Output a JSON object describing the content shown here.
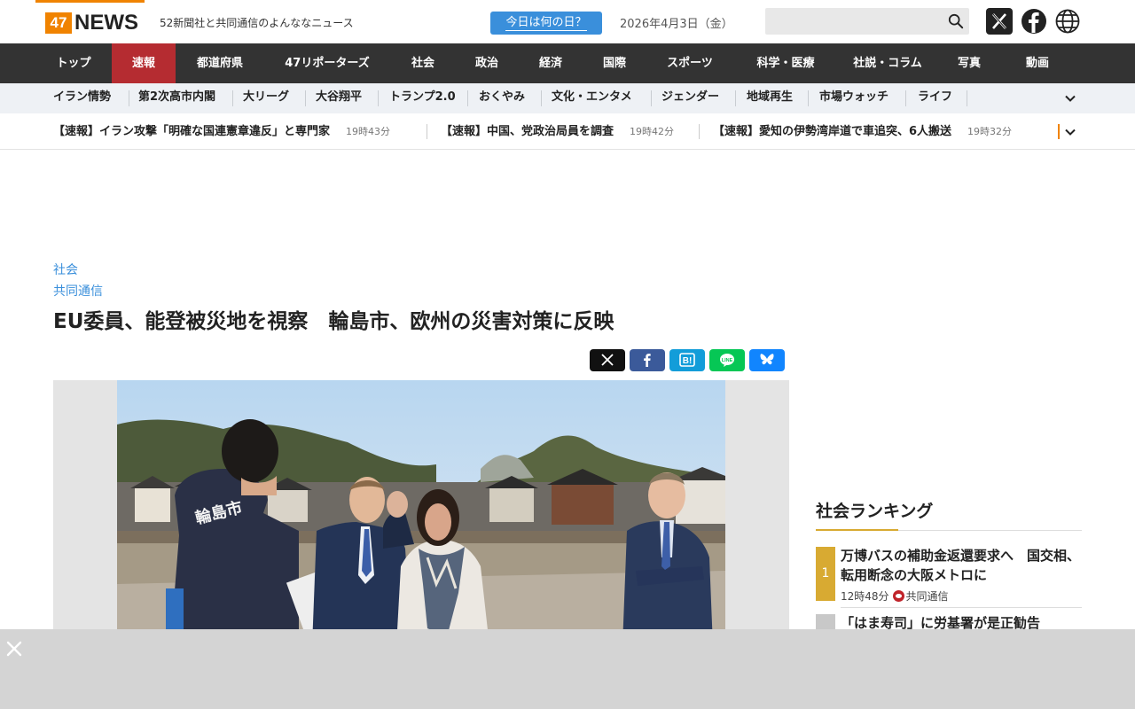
{
  "header": {
    "logo_num": "47",
    "logo_word": "NEWS",
    "tagline": "52新聞社と共同通信のよんななニュース",
    "today_button": "今日は何の日？",
    "date": "2026年4月3日（金）",
    "search_placeholder": ""
  },
  "main_nav": [
    "トップ",
    "速報",
    "都道府県",
    "47リポーターズ",
    "社会",
    "政治",
    "経済",
    "国際",
    "スポーツ",
    "科学・医療",
    "社説・コラム",
    "写真",
    "動画"
  ],
  "main_nav_active": "速報",
  "sub_nav": [
    "イラン情勢",
    "第2次高市内閣",
    "大リーグ",
    "大谷翔平",
    "トランプ2.0",
    "おくやみ",
    "文化・エンタメ",
    "ジェンダー",
    "地域再生",
    "市場ウォッチ",
    "ライフ"
  ],
  "ticker": [
    {
      "text": "【速報】イラン攻撃「明確な国連憲章違反」と専門家",
      "time": "19時43分"
    },
    {
      "text": "【速報】中国、党政治局員を調査",
      "time": "19時42分"
    },
    {
      "text": "【速報】愛知の伊勢湾岸道で車追突、6人搬送",
      "time": "19時32分"
    }
  ],
  "article": {
    "category": "社会",
    "source": "共同通信",
    "headline": "EU委員、能登被災地を視察　輪島市、欧州の災害対策に反映",
    "photo_text": "輪島市"
  },
  "share_buttons": [
    {
      "name": "x",
      "color": "#111111"
    },
    {
      "name": "facebook",
      "color": "#3b5a9a"
    },
    {
      "name": "hatena",
      "color": "#139dd9"
    },
    {
      "name": "line",
      "color": "#06c755"
    },
    {
      "name": "bluesky",
      "color": "#1185fe"
    }
  ],
  "ranking": {
    "title": "社会ランキング",
    "items": [
      {
        "rank": "1",
        "title": "万博バスの補助金返還要求へ　国交相、転用断念の大阪メトロに",
        "time": "12時48分",
        "source": "共同通信"
      },
      {
        "rank": "",
        "title": "「はま寿司」に労基署が是正勧告"
      }
    ]
  },
  "colors": {
    "accent_orange": "#f08300",
    "nav_dark": "#333333",
    "nav_active": "#b52c31",
    "link_blue": "#3a8fdb",
    "rank_gold": "#d8aa32"
  }
}
